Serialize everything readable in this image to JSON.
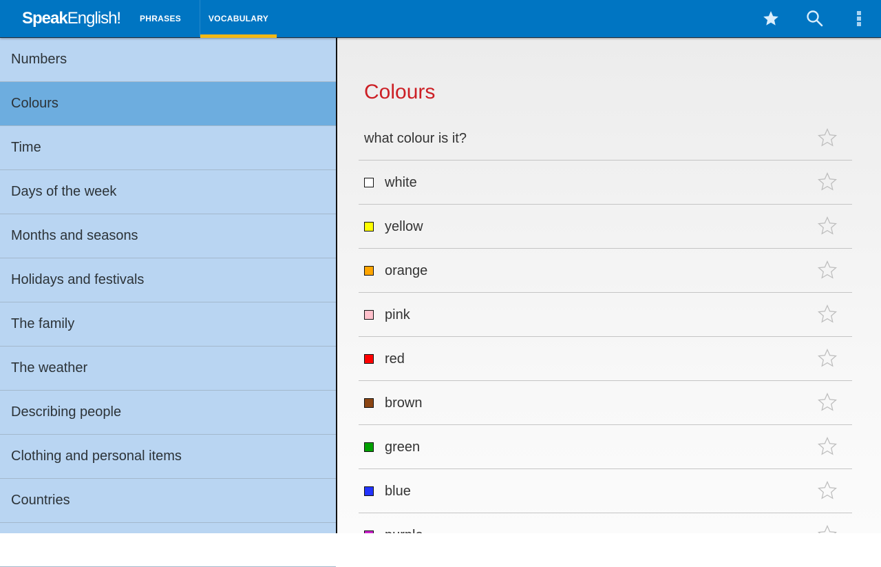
{
  "app": {
    "logo_bold": "Speak",
    "logo_thin": "English!"
  },
  "tabs": [
    {
      "label": "PHRASES",
      "active": false
    },
    {
      "label": "VOCABULARY",
      "active": true
    }
  ],
  "actions": {
    "favorites_icon": "star-filled",
    "search_icon": "magnifier",
    "overflow_icon": "vertical-dots"
  },
  "sidebar": {
    "items": [
      {
        "label": "Numbers"
      },
      {
        "label": "Colours",
        "active": true
      },
      {
        "label": "Time"
      },
      {
        "label": "Days of the week"
      },
      {
        "label": "Months and seasons"
      },
      {
        "label": "Holidays and festivals"
      },
      {
        "label": "The family"
      },
      {
        "label": "The weather"
      },
      {
        "label": "Describing people"
      },
      {
        "label": "Clothing and personal items"
      },
      {
        "label": "Countries"
      },
      {
        "label": ""
      }
    ]
  },
  "main": {
    "title": "Colours",
    "phrases": [
      {
        "text": "what colour is it?",
        "swatch": null
      },
      {
        "text": "white",
        "swatch": "#ffffff"
      },
      {
        "text": "yellow",
        "swatch": "#ffff00"
      },
      {
        "text": "orange",
        "swatch": "#ffa500"
      },
      {
        "text": "pink",
        "swatch": "#ffc0cb"
      },
      {
        "text": "red",
        "swatch": "#ff0000"
      },
      {
        "text": "brown",
        "swatch": "#8b4513"
      },
      {
        "text": "green",
        "swatch": "#00a000"
      },
      {
        "text": "blue",
        "swatch": "#2233ff"
      },
      {
        "text": "purple",
        "swatch": "#cc22cc"
      }
    ]
  },
  "colors": {
    "appbar": "#0075c2",
    "tab_indicator": "#f2b815",
    "sidebar_bg": "#b9d5f2",
    "sidebar_active": "#6daddf",
    "title_red": "#cc1f25"
  }
}
